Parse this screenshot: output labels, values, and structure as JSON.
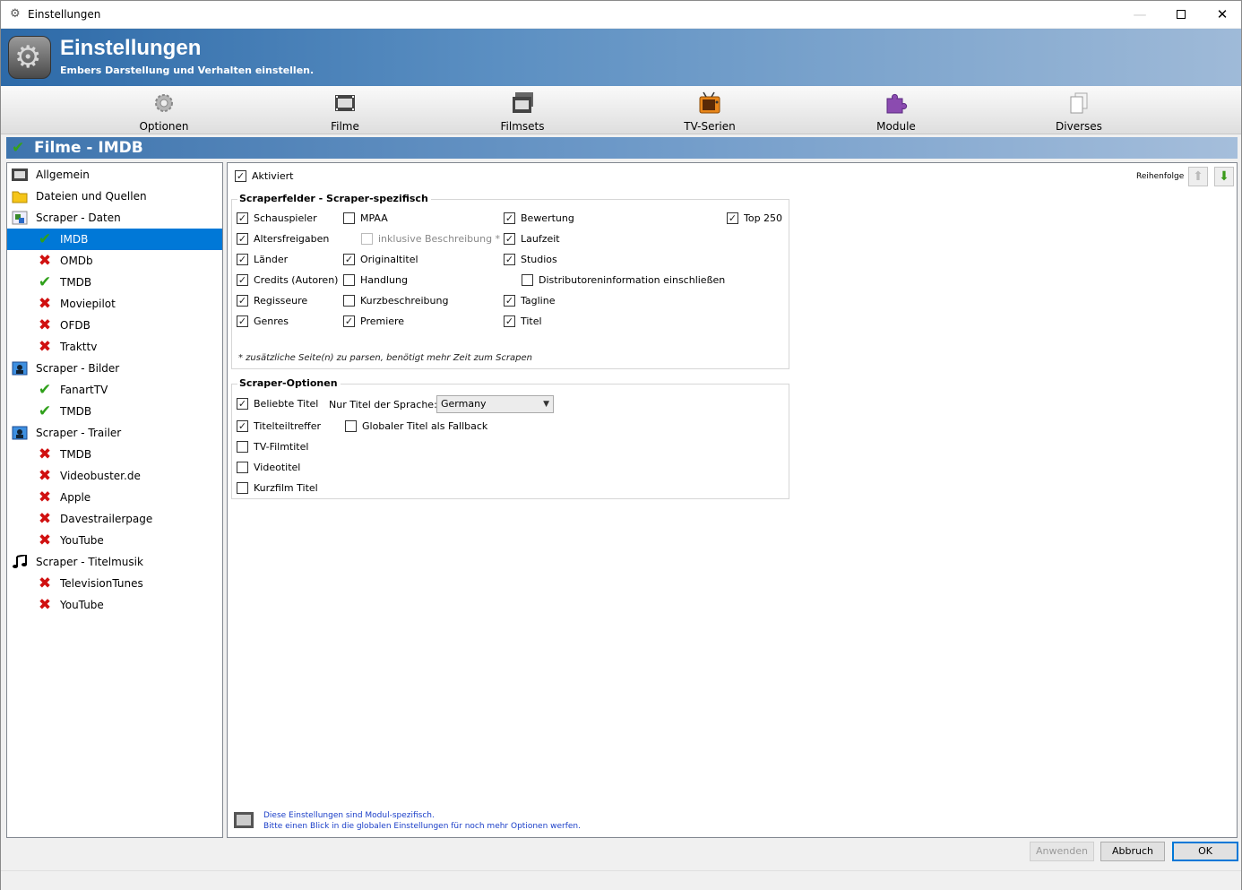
{
  "window": {
    "title": "Einstellungen"
  },
  "banner": {
    "title": "Einstellungen",
    "subtitle": "Embers Darstellung und Verhalten einstellen."
  },
  "toolbar": [
    {
      "label": "Optionen",
      "icon": "gear-icon"
    },
    {
      "label": "Filme",
      "icon": "film-icon"
    },
    {
      "label": "Filmsets",
      "icon": "filmsets-icon"
    },
    {
      "label": "TV-Serien",
      "icon": "tv-icon"
    },
    {
      "label": "Module",
      "icon": "puzzle-icon"
    },
    {
      "label": "Diverses",
      "icon": "documents-icon"
    }
  ],
  "section": {
    "title": "Filme - IMDB"
  },
  "tree": [
    {
      "label": "Allgemein",
      "icon": "film-icon",
      "level": 0
    },
    {
      "label": "Dateien und Quellen",
      "icon": "folder-icon",
      "level": 0
    },
    {
      "label": "Scraper - Daten",
      "icon": "data-scraper-icon",
      "level": 0
    },
    {
      "label": "IMDB",
      "icon": "check-icon",
      "level": 1,
      "selected": true
    },
    {
      "label": "OMDb",
      "icon": "cross-icon",
      "level": 1
    },
    {
      "label": "TMDB",
      "icon": "check-icon",
      "level": 1
    },
    {
      "label": "Moviepilot",
      "icon": "cross-icon",
      "level": 1
    },
    {
      "label": "OFDB",
      "icon": "cross-icon",
      "level": 1
    },
    {
      "label": "Trakttv",
      "icon": "cross-icon",
      "level": 1
    },
    {
      "label": "Scraper - Bilder",
      "icon": "image-scraper-icon",
      "level": 0
    },
    {
      "label": "FanartTV",
      "icon": "check-icon",
      "level": 1
    },
    {
      "label": "TMDB",
      "icon": "check-icon",
      "level": 1
    },
    {
      "label": "Scraper - Trailer",
      "icon": "image-scraper-icon",
      "level": 0
    },
    {
      "label": "TMDB",
      "icon": "cross-icon",
      "level": 1
    },
    {
      "label": "Videobuster.de",
      "icon": "cross-icon",
      "level": 1
    },
    {
      "label": "Apple",
      "icon": "cross-icon",
      "level": 1
    },
    {
      "label": "Davestrailerpage",
      "icon": "cross-icon",
      "level": 1
    },
    {
      "label": "YouTube",
      "icon": "cross-icon",
      "level": 1
    },
    {
      "label": "Scraper - Titelmusik",
      "icon": "music-icon",
      "level": 0
    },
    {
      "label": "TelevisionTunes",
      "icon": "cross-icon",
      "level": 1
    },
    {
      "label": "YouTube",
      "icon": "cross-icon",
      "level": 1
    }
  ],
  "panel": {
    "activated": {
      "label": "Aktiviert",
      "checked": true
    },
    "order_label": "Reihenfolge",
    "fields_group": {
      "title": "Scraperfelder - Scraper-spezifisch",
      "items": [
        {
          "label": "Schauspieler",
          "checked": true
        },
        {
          "label": "MPAA",
          "checked": false
        },
        {
          "label": "Bewertung",
          "checked": true
        },
        {
          "label": "Top 250",
          "checked": true
        },
        {
          "label": "Altersfreigaben",
          "checked": true
        },
        {
          "label": "inklusive Beschreibung *",
          "checked": false,
          "disabled": true
        },
        {
          "label": "Laufzeit",
          "checked": true
        },
        {
          "label": "Länder",
          "checked": true
        },
        {
          "label": "Originaltitel",
          "checked": true
        },
        {
          "label": "Studios",
          "checked": true
        },
        {
          "label": "Credits (Autoren)",
          "checked": true
        },
        {
          "label": "Handlung",
          "checked": false
        },
        {
          "label": "Distributoreninformation einschließen",
          "checked": false
        },
        {
          "label": "Regisseure",
          "checked": true
        },
        {
          "label": "Kurzbeschreibung",
          "checked": false
        },
        {
          "label": "Tagline",
          "checked": true
        },
        {
          "label": "Genres",
          "checked": true
        },
        {
          "label": "Premiere",
          "checked": true
        },
        {
          "label": "Titel",
          "checked": true
        }
      ],
      "note": "* zusätzliche Seite(n) zu parsen, benötigt mehr Zeit zum Scrapen"
    },
    "options_group": {
      "title": "Scraper-Optionen",
      "items": [
        {
          "label": "Beliebte Titel",
          "checked": true
        },
        {
          "label": "Titelteiltreffer",
          "checked": true
        },
        {
          "label": "Globaler Titel als Fallback",
          "checked": false
        },
        {
          "label": "TV-Filmtitel",
          "checked": false
        },
        {
          "label": "Videotitel",
          "checked": false
        },
        {
          "label": "Kurzfilm Titel",
          "checked": false
        }
      ],
      "language_label": "Nur Titel der Sprache:",
      "language_value": "Germany"
    },
    "footer_note": {
      "line1": "Diese Einstellungen sind Modul-spezifisch.",
      "line2": "Bitte einen Blick in die globalen Einstellungen für noch mehr Optionen werfen."
    }
  },
  "buttons": {
    "apply": "Anwenden",
    "cancel": "Abbruch",
    "ok": "OK"
  },
  "colors": {
    "accent": "#0078d7",
    "check": "#2fa01a",
    "cross": "#d01010",
    "banner": "#2d6aa8"
  }
}
